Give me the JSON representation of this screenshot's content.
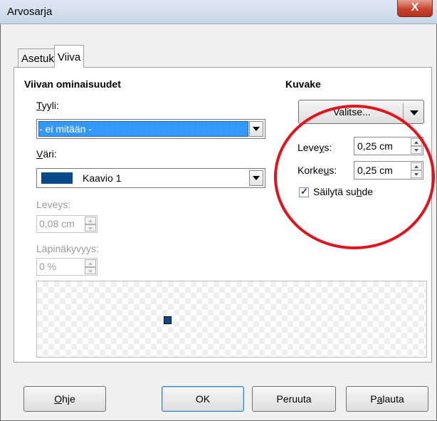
{
  "window": {
    "title": "Arvosarja",
    "close_glyph": "X"
  },
  "tabs": [
    {
      "label": "Asetukset"
    },
    {
      "label": "Viiva",
      "selected": true
    }
  ],
  "line_props": {
    "heading": "Viivan ominaisuudet",
    "style_label_pre": "",
    "style_label_ul": "T",
    "style_label_post": "yyli:",
    "style_value": "- ei mitään -",
    "color_label_ul": "V",
    "color_label_post": "äri:",
    "color_value": "Kaavio 1",
    "color_swatch": "#0b4a8a",
    "width_label": "Leveys:",
    "width_value": "0,08 cm",
    "transparency_label": "Läpinäkyvyys:",
    "transparency_value": "0 %"
  },
  "icon_props": {
    "heading": "Kuvake",
    "select_button": "Valitse...",
    "width_label_pre": "Leve",
    "width_label_ul": "y",
    "width_label_post": "s:",
    "width_value": "0,25 cm",
    "height_label_pre": "Korke",
    "height_label_ul": "u",
    "height_label_post": "s:",
    "height_value": "0,25 cm",
    "keep_ratio_pre": "Säilytä su",
    "keep_ratio_ul": "h",
    "keep_ratio_post": "de",
    "keep_ratio_checked": true
  },
  "buttons": {
    "help_ul": "O",
    "help_post": "hje",
    "ok": "OK",
    "cancel": "Peruuta",
    "reset_pre": "P",
    "reset_ul": "a",
    "reset_post": "lauta"
  },
  "colors": {
    "highlight_circle": "#e3121b",
    "selection": "#3399ff",
    "preview_marker": "#0b4a8a"
  }
}
